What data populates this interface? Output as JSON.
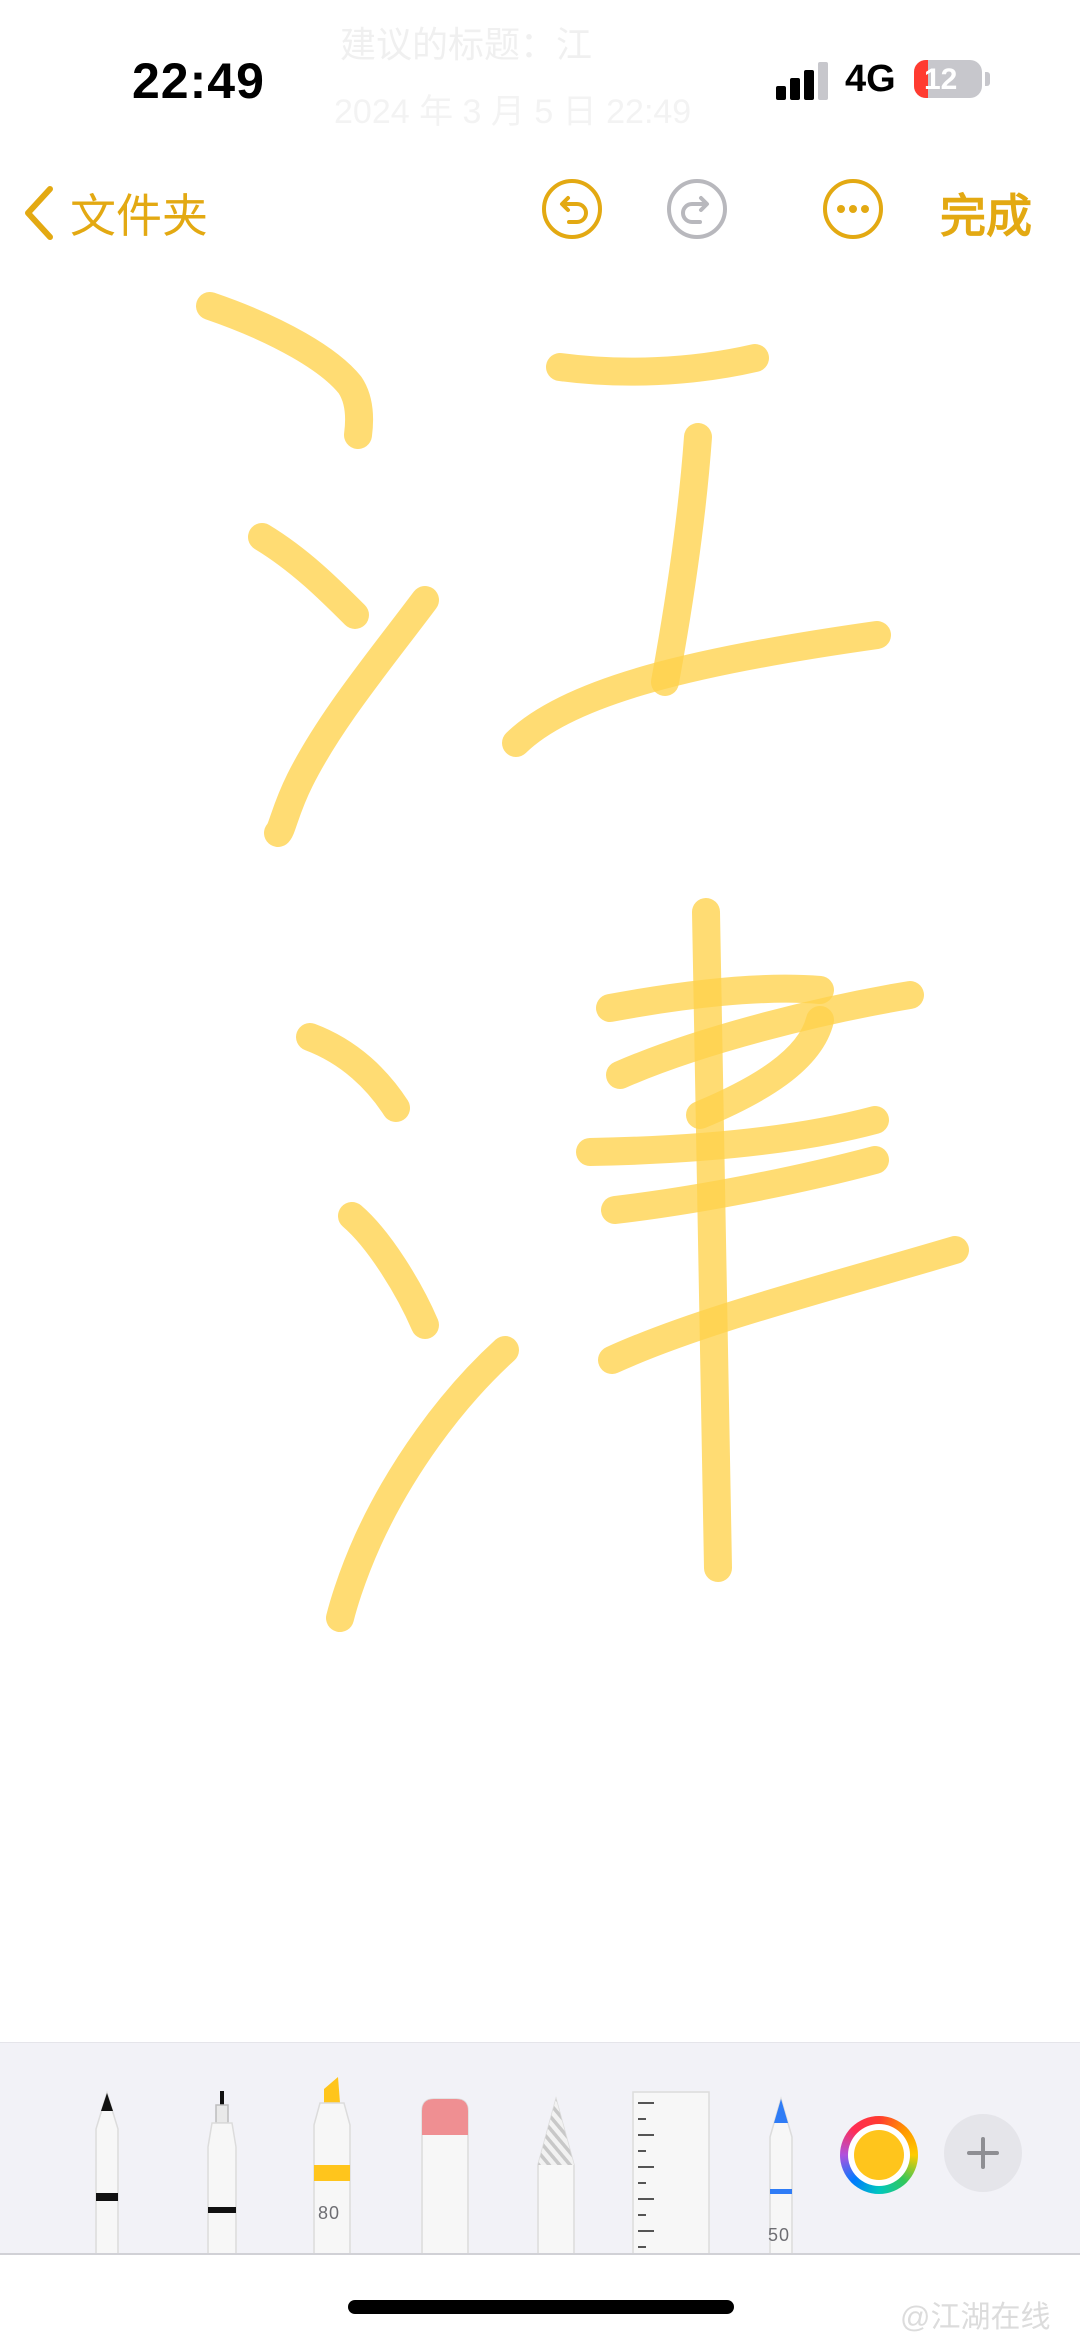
{
  "status_bar": {
    "time": "22:49",
    "network": "4G",
    "battery": "12"
  },
  "ghost_header": {
    "title": "建议的标题：江",
    "date": "2024 年 3 月 5 日 22:49"
  },
  "nav": {
    "back_label": "文件夹",
    "done_label": "完成",
    "accent_color": "#e3a912"
  },
  "drawing": {
    "ink_color": "#ffd24c"
  },
  "tools": {
    "highlighter_width": "80",
    "crayon_width": "50",
    "selected_color": "#ffc51c"
  },
  "watermark": "@江湖在线"
}
